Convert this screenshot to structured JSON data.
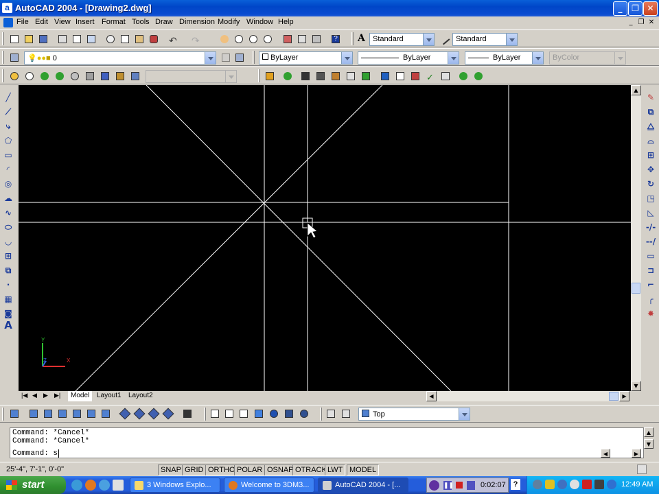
{
  "window": {
    "title": "AutoCAD 2004 - [Drawing2.dwg]",
    "app_icon_letter": "a"
  },
  "menu": [
    "File",
    "Edit",
    "View",
    "Insert",
    "Format",
    "Tools",
    "Draw",
    "Dimension",
    "Modify",
    "Window",
    "Help"
  ],
  "styles": {
    "text_style": "Standard",
    "dim_style": "Standard"
  },
  "layers": {
    "current": "0",
    "color": "ByLayer",
    "linetype": "ByLayer",
    "lineweight": "ByLayer",
    "plotstyle": "ByColor"
  },
  "layout_tabs": [
    "Model",
    "Layout1",
    "Layout2"
  ],
  "view": {
    "current": "Top"
  },
  "command": {
    "history": [
      "Command: *Cancel*",
      "Command: *Cancel*"
    ],
    "prompt": "Command: s"
  },
  "status": {
    "coords": "25'-4\", 7'-1\", 0'-0\"",
    "toggles": [
      "SNAP",
      "GRID",
      "ORTHO",
      "POLAR",
      "OSNAP",
      "OTRACK",
      "LWT",
      "MODEL"
    ]
  },
  "ucs": {
    "x_label": "X",
    "y_label": "Y",
    "z_label": "Z"
  },
  "taskbar": {
    "start": "start",
    "tasks": [
      {
        "label": "3 Windows Explo...",
        "active": false
      },
      {
        "label": "Welcome to 3DM3...",
        "active": false
      },
      {
        "label": "AutoCAD 2004 - [...",
        "active": true
      }
    ],
    "recorder_time": "0:02:07",
    "clock": "12:49 AM"
  },
  "colors": {
    "canvas_bg": "#000000",
    "drawing_lines": "#ffffff",
    "taskbar_blue": "#245ddb",
    "start_green": "#2f8f2f"
  }
}
